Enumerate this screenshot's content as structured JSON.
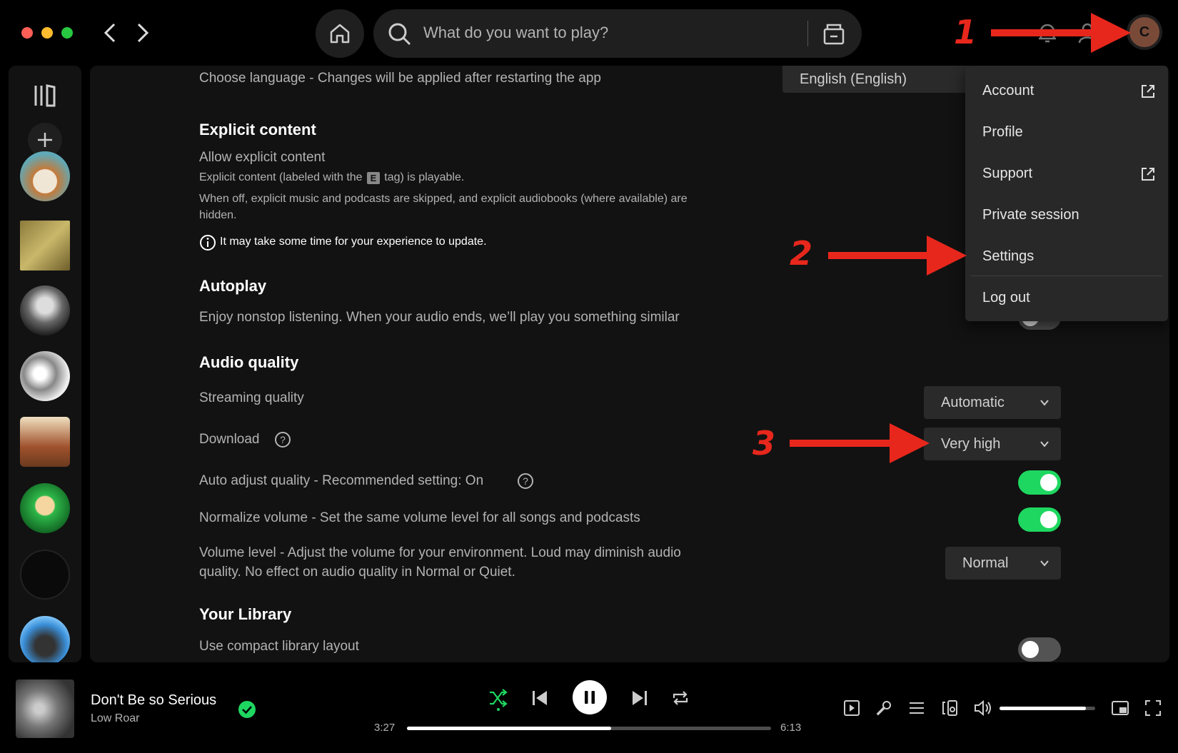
{
  "search": {
    "placeholder": "What do you want to play?"
  },
  "user": {
    "initial": "C"
  },
  "settings": {
    "language_row": "Choose language - Changes will be applied after restarting the app",
    "language_value": "English (English)",
    "explicit": {
      "title": "Explicit content",
      "label": "Allow explicit content",
      "desc1_a": "Explicit content (labeled with the",
      "tag": "E",
      "desc1_b": "tag) is playable.",
      "desc2": "When off, explicit music and podcasts are skipped, and explicit audiobooks (where available) are",
      "desc2b": "hidden.",
      "note": "It may take some time for your experience to update."
    },
    "autoplay": {
      "title": "Autoplay",
      "label": "Enjoy nonstop listening. When your audio ends, we’ll play you something similar"
    },
    "audio_quality": {
      "title": "Audio quality",
      "streaming_label": "Streaming quality",
      "streaming_value": "Automatic",
      "download_label": "Download",
      "download_value": "Very high",
      "auto_adjust_label": "Auto adjust quality - Recommended setting: On",
      "auto_adjust_on": true,
      "normalize_label": "Normalize volume - Set the same volume level for all songs and podcasts",
      "normalize_on": true,
      "volume_level_line1": "Volume level - Adjust the volume for your environment. Loud may diminish audio",
      "volume_level_line2": "quality. No effect on audio quality in Normal or Quiet.",
      "volume_level_value": "Normal"
    },
    "library": {
      "title": "Your Library",
      "compact_label": "Use compact library layout",
      "compact_on": false
    }
  },
  "menu": {
    "items": [
      {
        "label": "Account"
      },
      {
        "label": "Profile"
      },
      {
        "label": "Support"
      },
      {
        "label": "Private session"
      },
      {
        "label": "Settings"
      },
      {
        "label": "Log out"
      }
    ]
  },
  "annotations": {
    "n1": "1",
    "n2": "2",
    "n3": "3"
  },
  "player": {
    "track_title": "Don't Be so Serious",
    "artist": "Low Roar",
    "elapsed": "3:27",
    "duration": "6:13",
    "progress": 0.56,
    "volume": 0.9
  },
  "colors": {
    "accent": "#1ed760",
    "annotation": "#e8271c",
    "bg": "#121212"
  }
}
